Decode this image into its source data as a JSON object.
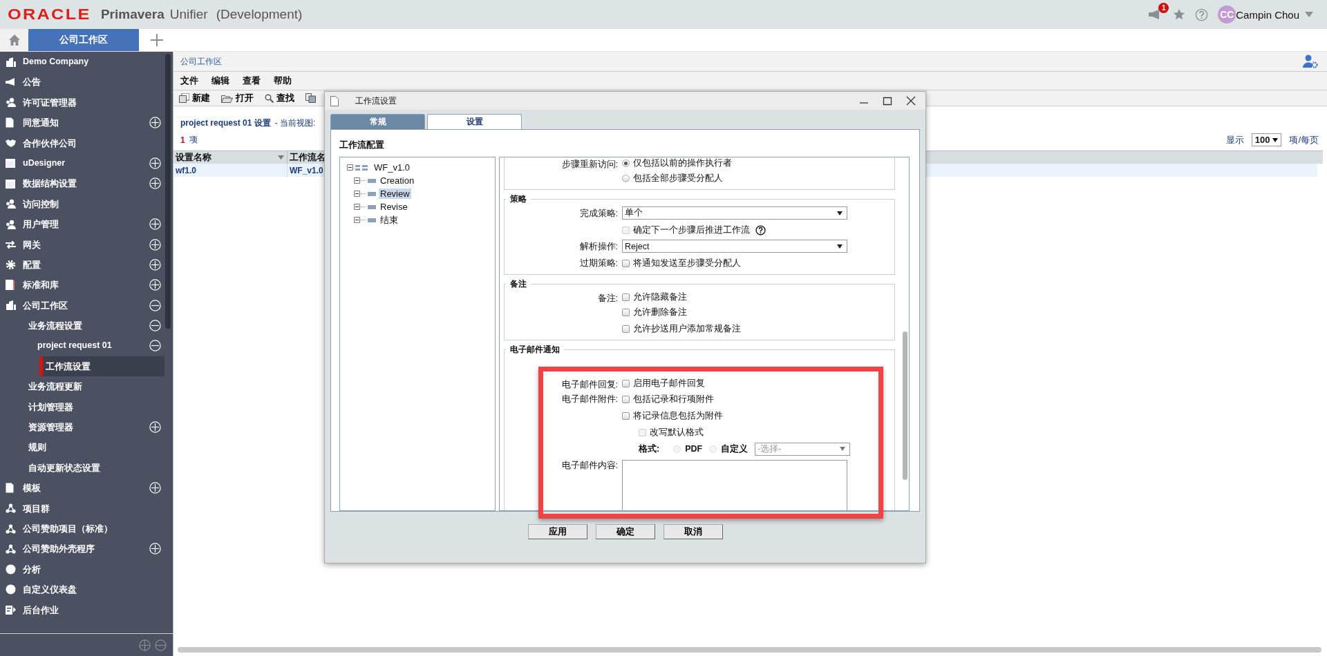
{
  "app": {
    "brand": "ORACLE",
    "product": "Primavera",
    "module": "Unifier",
    "env": "(Development)"
  },
  "header": {
    "notifications": "1",
    "user_initials": "CC",
    "user_name": "Campin Chou"
  },
  "tabs": [
    {
      "label": "公司工作区",
      "selected": true
    }
  ],
  "sidebar": {
    "items": [
      {
        "label": "Demo Company",
        "selected": false
      },
      {
        "label": "公告",
        "selected": false
      },
      {
        "label": "许可证管理器",
        "selected": false
      },
      {
        "label": "同意通知",
        "selected": false,
        "expanded": false
      },
      {
        "label": "合作伙伴公司",
        "selected": false
      },
      {
        "label": "uDesigner",
        "selected": false,
        "expanded": false
      },
      {
        "label": "数据结构设置",
        "selected": false,
        "expanded": false
      },
      {
        "label": "访问控制",
        "selected": false
      },
      {
        "label": "用户管理",
        "selected": false,
        "expanded": false
      },
      {
        "label": "网关",
        "selected": false,
        "expanded": false
      },
      {
        "label": "配置",
        "selected": false,
        "expanded": false
      },
      {
        "label": "标准和库",
        "selected": false,
        "expanded": false
      },
      {
        "label": "公司工作区",
        "selected": false,
        "expanded": true,
        "children": [
          {
            "label": "业务流程设置",
            "selected": false,
            "expanded": true,
            "children": [
              {
                "label": "project request 01",
                "selected": false,
                "expanded": true,
                "children": [
                  {
                    "label": "工作流设置",
                    "selected": true
                  }
                ]
              }
            ]
          },
          {
            "label": "业务流程更新",
            "selected": false
          },
          {
            "label": "计划管理器",
            "selected": false
          },
          {
            "label": "资源管理器",
            "selected": false,
            "expanded": false
          },
          {
            "label": "规则",
            "selected": false
          },
          {
            "label": "自动更新状态设置",
            "selected": false
          }
        ]
      },
      {
        "label": "模板",
        "selected": false,
        "expanded": false
      },
      {
        "label": "项目群",
        "selected": false
      },
      {
        "label": "公司赞助项目（标准）",
        "selected": false
      },
      {
        "label": "公司赞助外壳程序",
        "selected": false,
        "expanded": false
      },
      {
        "label": "分析",
        "selected": false
      },
      {
        "label": "自定义仪表盘",
        "selected": false
      },
      {
        "label": "后台作业",
        "selected": false
      }
    ]
  },
  "main": {
    "breadcrumb": "公司工作区",
    "menu": [
      "文件",
      "编辑",
      "查看",
      "帮助"
    ],
    "toolbar": [
      "新建",
      "打开",
      "查找"
    ],
    "title": "project request 01 设置",
    "view_label": "- 当前视图:",
    "count": "1",
    "count_unit": "项",
    "page_size": {
      "label": "显示",
      "value": "100",
      "unit": "项/每页"
    },
    "table": {
      "columns": [
        "设置名称",
        "工作流名"
      ],
      "rows": [
        [
          "wf1.0",
          "WF_v1.0"
        ]
      ]
    }
  },
  "dialog": {
    "title": "工作流设置",
    "tabs": [
      {
        "label": "常规",
        "selected": false
      },
      {
        "label": "设置",
        "selected": true
      }
    ],
    "section_title": "工作流配置",
    "tree": {
      "label": "WF_v1.0",
      "children": [
        {
          "label": "Creation",
          "selected": false
        },
        {
          "label": "Review",
          "selected": true
        },
        {
          "label": "Revise",
          "selected": false
        },
        {
          "label": "结束",
          "selected": false
        }
      ]
    },
    "sections": [
      {
        "rows": [
          {
            "kind": "radio",
            "label": "步骤重新访问:",
            "options": [
              {
                "label": "仅包括以前的操作执行者",
                "selected": true
              },
              {
                "label": "包括全部步骤受分配人",
                "selected": false
              }
            ]
          }
        ]
      },
      {
        "title": "策略",
        "rows": [
          {
            "kind": "select",
            "label": "完成策略:",
            "value": "单个"
          },
          {
            "kind": "checkbox",
            "options": [
              {
                "label": "确定下一个步骤后推进工作流",
                "checked": false,
                "disabled": true,
                "help": true
              }
            ]
          },
          {
            "kind": "select",
            "label": "解析操作:",
            "value": "Reject"
          },
          {
            "kind": "checkbox",
            "label": "过期策略:",
            "options": [
              {
                "label": "将通知发送至步骤受分配人",
                "checked": false,
                "disabled": false
              }
            ]
          }
        ]
      },
      {
        "title": "备注",
        "rows": [
          {
            "kind": "checkbox",
            "label": "备注:",
            "options": [
              {
                "label": "允许隐藏备注",
                "checked": false,
                "disabled": false
              },
              {
                "label": "允许删除备注",
                "checked": false,
                "disabled": false
              },
              {
                "label": "允许抄送用户添加常规备注",
                "checked": false,
                "disabled": false
              }
            ]
          }
        ]
      },
      {
        "title": "电子邮件通知",
        "rows": [
          {
            "kind": "checkbox",
            "label": "电子邮件回复:",
            "options": [
              {
                "label": "启用电子邮件回复",
                "checked": false,
                "disabled": false
              }
            ]
          },
          {
            "kind": "checkbox",
            "label": "电子邮件附件:",
            "options": [
              {
                "label": "包括记录和行项附件",
                "checked": false,
                "disabled": false
              },
              {
                "label": "将记录信息包括为附件",
                "checked": false,
                "disabled": false,
                "children": [
                  {
                    "label": "改写默认格式",
                    "checked": false,
                    "disabled": true
                  }
                ]
              }
            ]
          },
          {
            "kind": "format",
            "label": "格式:",
            "options": [
              {
                "label": "PDF",
                "selected": false,
                "disabled": true
              },
              {
                "label": "自定义",
                "selected": false,
                "disabled": true
              }
            ],
            "placeholder": "-选择-"
          },
          {
            "kind": "textarea",
            "label": "电子邮件内容:"
          }
        ]
      }
    ],
    "buttons": [
      "应用",
      "确定",
      "取消"
    ]
  }
}
